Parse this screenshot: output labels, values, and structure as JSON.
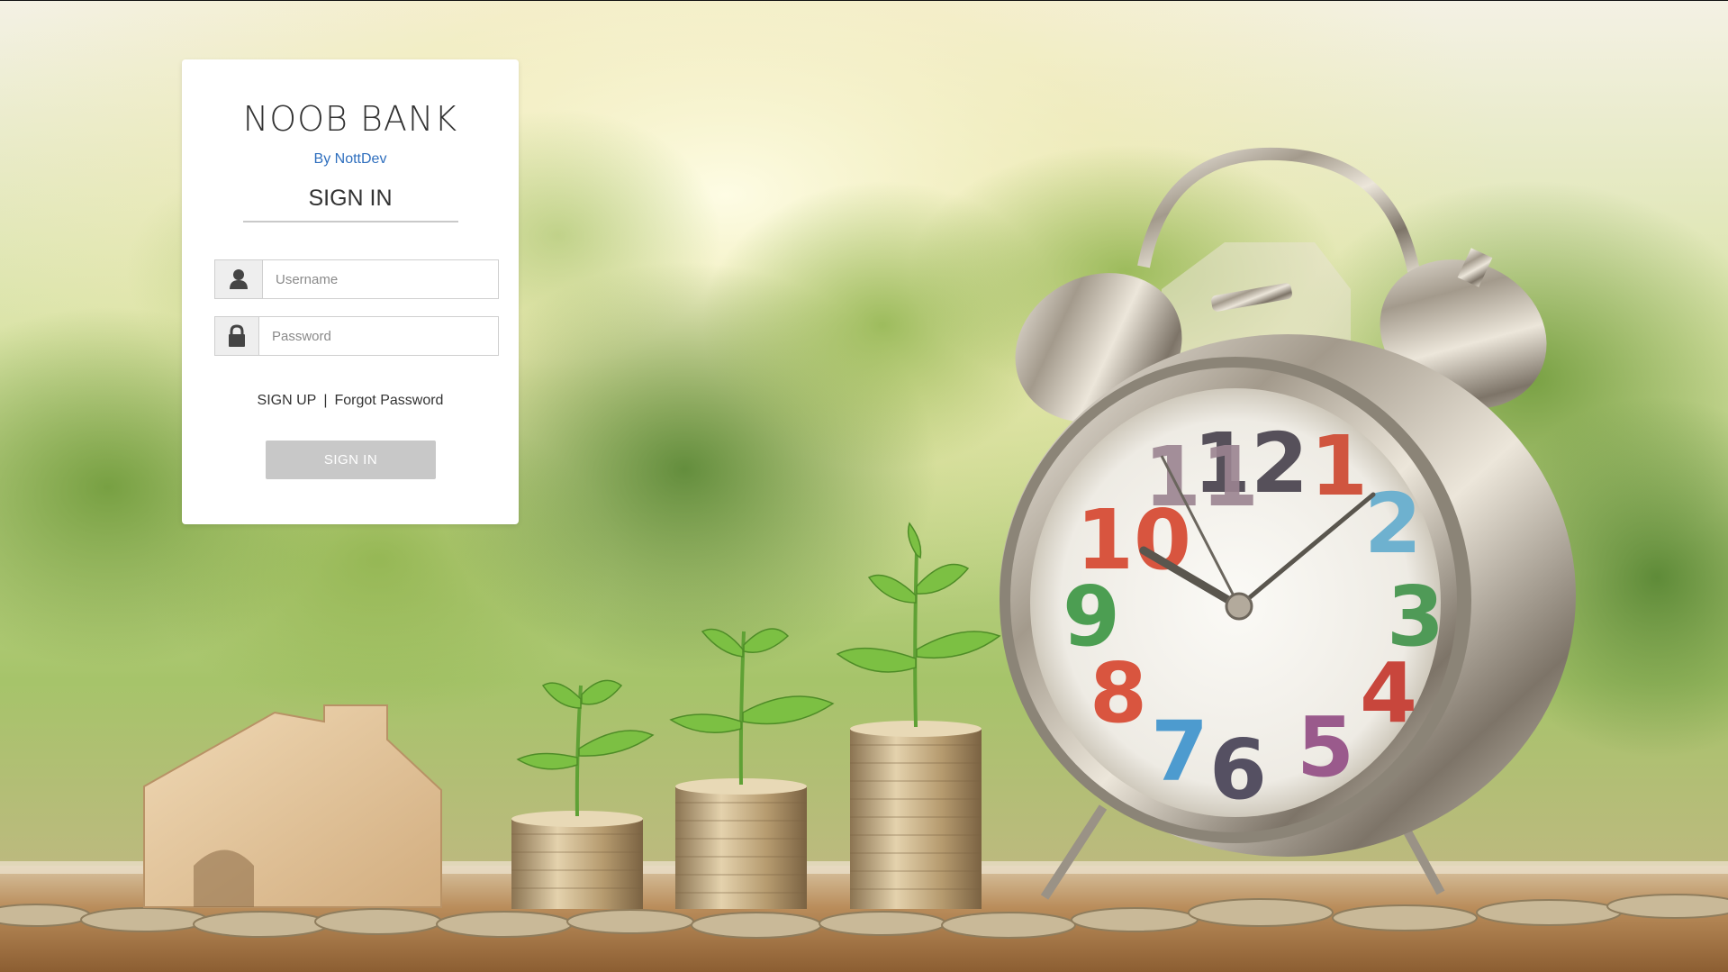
{
  "login": {
    "brand": "NOOB BANK",
    "byline": "By NottDev",
    "title": "SIGN IN",
    "username_placeholder": "Username",
    "password_placeholder": "Password",
    "signup_link": "SIGN UP",
    "separator": "|",
    "forgot_link": "Forgot Password",
    "submit_label": "SIGN IN"
  },
  "icons": {
    "username": "user-icon",
    "password": "lock-icon"
  },
  "colors": {
    "byline": "#2f6fbe",
    "button_bg": "#c8c8c8",
    "card_bg": "#ffffff"
  }
}
